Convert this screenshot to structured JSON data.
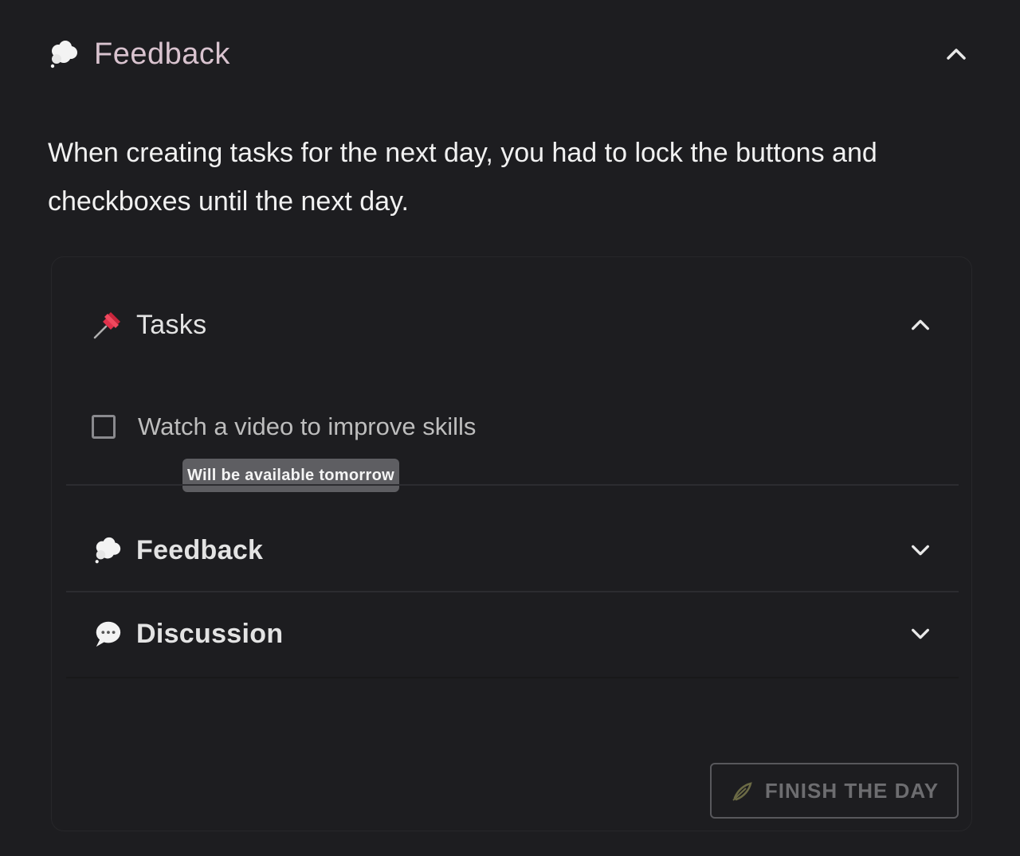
{
  "outer": {
    "title": "Feedback",
    "icon": "thought-balloon-icon",
    "toggle_icon": "chevron-up-icon",
    "description": "When creating tasks for the next day, you had to lock the buttons and checkboxes until the next day."
  },
  "card": {
    "sections": [
      {
        "title": "Tasks",
        "icon": "pushpin-icon",
        "toggle_icon": "chevron-up-icon",
        "expanded": true
      },
      {
        "title": "Feedback",
        "icon": "thought-balloon-icon",
        "toggle_icon": "chevron-down-icon",
        "expanded": false
      },
      {
        "title": "Discussion",
        "icon": "speech-balloon-icon",
        "toggle_icon": "chevron-down-icon",
        "expanded": false
      }
    ],
    "tasks": [
      {
        "label": "Watch a video to improve skills",
        "checked": false,
        "disabled": true
      }
    ],
    "tooltip": "Will be available tomorrow",
    "finish_button": {
      "label": "FINISH THE DAY",
      "icon": "sprout-icon",
      "disabled": true
    }
  },
  "colors": {
    "background": "#1d1d20",
    "outer_title": "#d9c3cf",
    "tooltip_bg": "#5e5e62",
    "disabled_text": "#6d6d70"
  }
}
